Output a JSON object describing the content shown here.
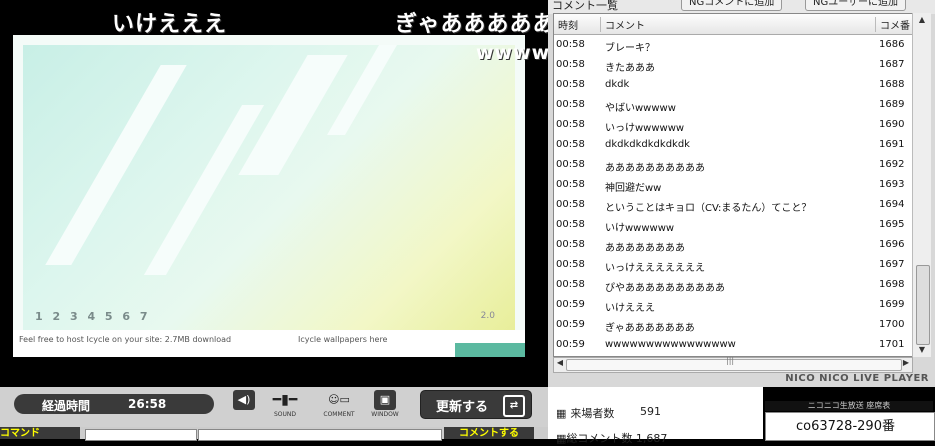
{
  "video": {
    "overlay_comments": [
      "いけえええ",
      "ぎゃあああああ",
      "wwww"
    ],
    "footer_left": "Feel free to host Icycle on your site: 2.7MB download",
    "footer_right": "Icycle wallpapers here",
    "digit_strip": "1 2 3 4 5 6 7",
    "corner_text": "2.0"
  },
  "comments_panel": {
    "title": "コメント一覧",
    "ng_comment_button": "NGコメントに追加",
    "ng_user_button": "NGユーザーに追加",
    "headers": [
      "時刻",
      "コメント",
      "コメ番"
    ],
    "rows": [
      [
        "00:58",
        "ブレーキ？",
        "1686"
      ],
      [
        "00:58",
        "きたあああ",
        "1687"
      ],
      [
        "00:58",
        "dkdk",
        "1688"
      ],
      [
        "00:58",
        "やばいwwwww",
        "1689"
      ],
      [
        "00:58",
        "いっけwwwwww",
        "1690"
      ],
      [
        "00:58",
        "dkdkdkdkdkdkdk",
        "1691"
      ],
      [
        "00:58",
        "ああああああああああ",
        "1692"
      ],
      [
        "00:58",
        "神回避だww",
        "1693"
      ],
      [
        "00:58",
        "ということはキョロ（CV:まるたん）てこと？",
        "1694"
      ],
      [
        "00:58",
        "いけwwwwww",
        "1695"
      ],
      [
        "00:58",
        "ああああああああ",
        "1696"
      ],
      [
        "00:58",
        "いっけえええええええ",
        "1697"
      ],
      [
        "00:58",
        "ぴやああああああああああ",
        "1698"
      ],
      [
        "00:59",
        "いけえええ",
        "1699"
      ],
      [
        "00:59",
        "ぎゃあああああああ",
        "1700"
      ],
      [
        "00:59",
        "wwwwwwwwwwwwwwww",
        "1701"
      ]
    ],
    "brand": "NICO NICO LIVE PLAYER"
  },
  "controls": {
    "elapsed_label": "経過時間",
    "elapsed_value": "26:58",
    "sound_label": "SOUND",
    "comment_label": "COMMENT",
    "window_label": "WINDOW",
    "update_button": "更新する",
    "command_button": "コマンド",
    "post_button": "コメントする"
  },
  "stats": {
    "visitors_label": "来場者数",
    "visitors_value": "591",
    "comments_label": "総コメント数",
    "comments_value": "1,687"
  },
  "live": {
    "header": "ニコニコ生放送 座席表",
    "seat": "co63728-290番"
  },
  "icons": [
    "speaker-icon",
    "volume-slider-icon",
    "comment-toggle-icon",
    "window-icon",
    "refresh-icon"
  ]
}
